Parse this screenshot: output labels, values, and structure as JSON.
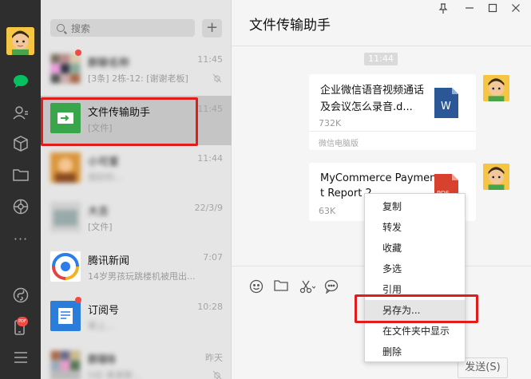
{
  "rail": {
    "icons": [
      "chat-icon",
      "contacts-icon",
      "favorites-icon",
      "files-icon",
      "moments-icon",
      "more-icon",
      "mini-program-icon",
      "phone-icon",
      "menu-icon"
    ]
  },
  "search": {
    "placeholder": "搜索",
    "add": "+"
  },
  "chats": [
    {
      "name": "群聊名称",
      "subtitle": "[3条] 2栋-12: [谢谢老板]",
      "time": "11:45",
      "unread": true,
      "muted": true
    },
    {
      "name": "文件传输助手",
      "subtitle": "[文件]",
      "time": "11:45",
      "selected": true
    },
    {
      "name": "小可爱",
      "subtitle": "很好的...",
      "time": "11:44",
      "unread": false
    },
    {
      "name": "大吉",
      "subtitle": "[文件]",
      "time": "22/3/9"
    },
    {
      "name": "腾讯新闻",
      "subtitle": "14岁男孩玩跳楼机被甩出...",
      "time": "7:07"
    },
    {
      "name": "订阅号",
      "subtitle": "掌上...",
      "time": "10:28",
      "unread": true
    },
    {
      "name": "群聊B",
      "subtitle": "D区·某某群...",
      "time": "昨天",
      "muted": true
    }
  ],
  "chat": {
    "title": "文件传输助手",
    "time_chip": "11:44",
    "files": [
      {
        "name": "企业微信语音视频通话及会议怎么录音.d...",
        "size": "732K",
        "source": "微信电脑版",
        "type": "W"
      },
      {
        "name": "MyCommerce Payment Report 2...",
        "size": "63K",
        "type": "PDF"
      }
    ],
    "send_label": "发送(S)"
  },
  "window_buttons": [
    "pin",
    "minimize",
    "maximize",
    "close"
  ],
  "context_menu": {
    "items": [
      "复制",
      "转发",
      "收藏",
      "多选",
      "引用",
      "另存为...",
      "在文件夹中显示",
      "删除"
    ],
    "highlighted": "另存为..."
  },
  "badge": {
    "phone": "PDF"
  },
  "colors": {
    "accent": "#07c160",
    "highlight": "#e11c1c",
    "rail": "#2e2e2e"
  }
}
